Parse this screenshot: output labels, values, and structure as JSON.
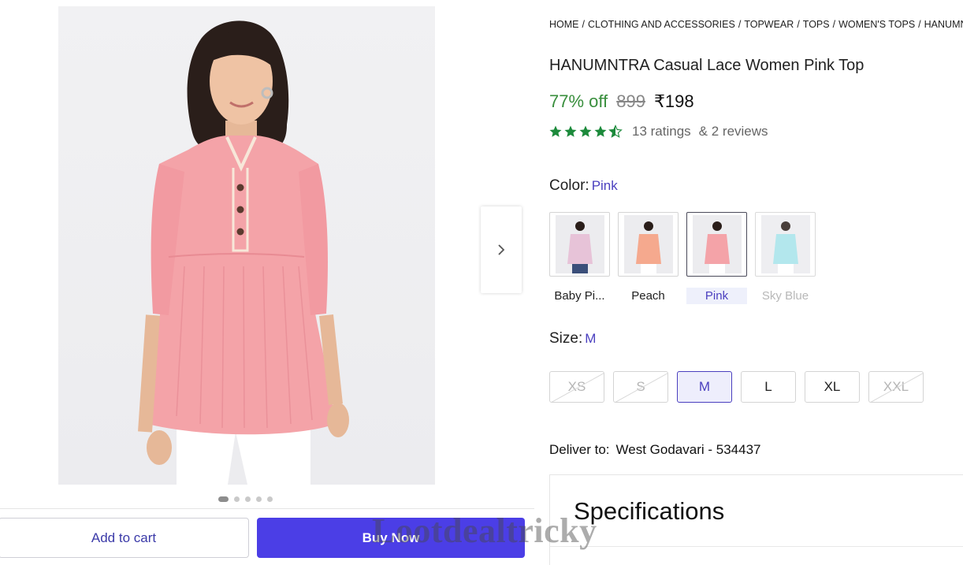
{
  "breadcrumb": [
    "HOME",
    "CLOTHING AND ACCESSORIES",
    "TOPWEAR",
    "TOPS",
    "WOMEN'S TOPS",
    "HANUMN"
  ],
  "product": {
    "title": "HANUMNTRA Casual Lace Women Pink Top",
    "discount": "77% off",
    "mrp": "899",
    "price": "₹198",
    "rating_stars": 4.5,
    "ratings": "13 ratings",
    "reviews": "& 2 reviews"
  },
  "color": {
    "label": "Color:",
    "selected": "Pink",
    "options": [
      {
        "name": "Baby Pi...",
        "hex": "#e7c3d8",
        "state": "normal"
      },
      {
        "name": "Peach",
        "hex": "#f5a98e",
        "state": "normal"
      },
      {
        "name": "Pink",
        "hex": "#f4a3a8",
        "state": "selected"
      },
      {
        "name": "Sky Blue",
        "hex": "#a6e3ea",
        "state": "disabled"
      }
    ]
  },
  "size": {
    "label": "Size:",
    "selected": "M",
    "options": [
      {
        "name": "XS",
        "state": "disabled"
      },
      {
        "name": "S",
        "state": "disabled"
      },
      {
        "name": "M",
        "state": "selected"
      },
      {
        "name": "L",
        "state": "normal"
      },
      {
        "name": "XL",
        "state": "normal"
      },
      {
        "name": "XXL",
        "state": "disabled"
      }
    ]
  },
  "delivery": {
    "label": "Deliver to:",
    "location": "West Godavari - 534437"
  },
  "specifications": {
    "title": "Specifications"
  },
  "actions": {
    "add_to_cart": "Add to cart",
    "buy_now": "Buy Now"
  },
  "gallery": {
    "count": 5,
    "active_index": 0
  },
  "watermark": "Lootdealtricky",
  "colors": {
    "accent": "#4b3ee6",
    "discount_green": "#388e3c",
    "star_green": "#1c8a3b",
    "product_pink": "#f4a3a8"
  },
  "icons": {
    "next": "chevron-right-icon",
    "star": "star-icon"
  }
}
